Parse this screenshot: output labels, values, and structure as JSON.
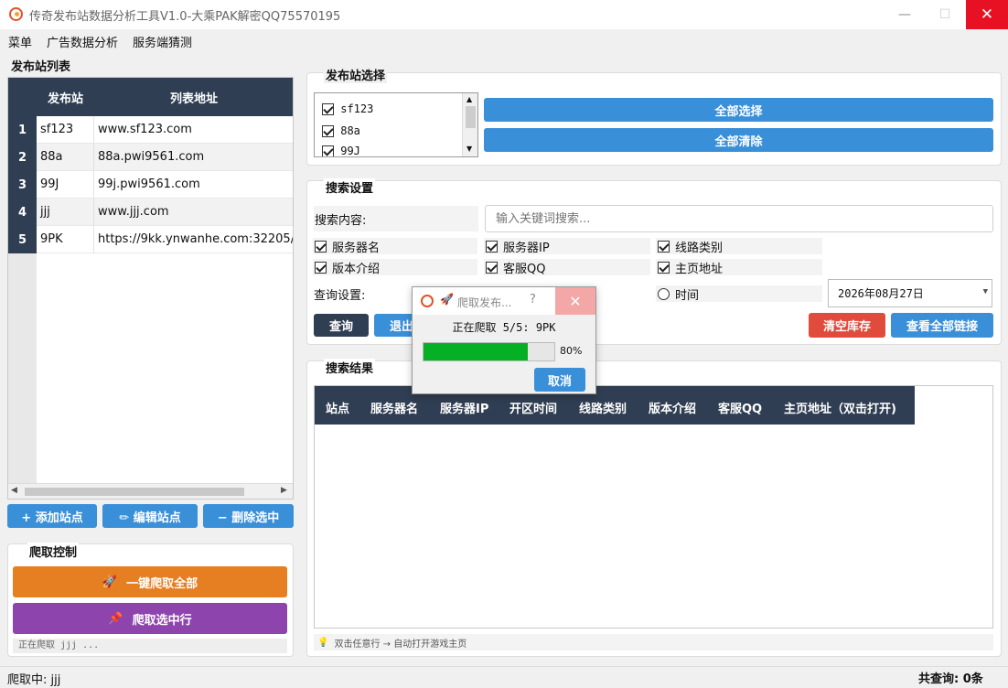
{
  "window": {
    "title": "传奇发布站数据分析工具V1.0-大乘PAK解密QQ75570195",
    "minimize": "—",
    "maximize": "☐",
    "close": "✕"
  },
  "menu": [
    "菜单",
    "广告数据分析",
    "服务端猜测"
  ],
  "site_list": {
    "label": "发布站列表",
    "columns": [
      "发布站",
      "列表地址"
    ],
    "rows": [
      {
        "num": "1",
        "site": "sf123",
        "url": "www.sf123.com"
      },
      {
        "num": "2",
        "site": "88a",
        "url": "88a.pwi9561.com"
      },
      {
        "num": "3",
        "site": "99J",
        "url": "99j.pwi9561.com"
      },
      {
        "num": "4",
        "site": "jjj",
        "url": "www.jjj.com"
      },
      {
        "num": "5",
        "site": "9PK",
        "url": "https://9kk.ynwanhe.com:32205/"
      }
    ],
    "buttons": {
      "add": "+ 添加站点",
      "edit": "✏ 编辑站点",
      "delete": "− 删除选中"
    }
  },
  "crawl_control": {
    "label": "爬取控制",
    "crawl_all": "一键爬取全部",
    "crawl_selected": "爬取选中行",
    "status": "正在爬取 jjj ..."
  },
  "site_select": {
    "label": "发布站选择",
    "items": [
      {
        "label": "sf123",
        "checked": true
      },
      {
        "label": "88a",
        "checked": true
      },
      {
        "label": "99J",
        "checked": true
      }
    ],
    "select_all": "全部选择",
    "clear_all": "全部清除"
  },
  "search": {
    "label": "搜索设置",
    "content_label": "搜索内容:",
    "placeholder": "输入关键词搜索...",
    "fields": [
      {
        "label": "服务器名",
        "checked": true
      },
      {
        "label": "服务器IP",
        "checked": true
      },
      {
        "label": "线路类别",
        "checked": true
      },
      {
        "label": "版本介绍",
        "checked": true
      },
      {
        "label": "客服QQ",
        "checked": true
      },
      {
        "label": "主页地址",
        "checked": true
      }
    ],
    "query_label": "查询设置:",
    "time_label": "时间",
    "date": "2026年08月27日",
    "query_btn": "查询",
    "exit_btn": "退出",
    "clear_btn": "清空库存",
    "view_links_btn": "查看全部链接"
  },
  "results": {
    "label": "搜索结果",
    "columns": [
      "站点",
      "服务器名",
      "服务器IP",
      "开区时间",
      "线路类别",
      "版本介绍",
      "客服QQ",
      "主页地址（双击打开)"
    ],
    "hint": "双击任意行 → 自动打开游戏主页"
  },
  "dialog": {
    "title": "爬取发布...",
    "help": "?",
    "close": "✕",
    "message": "正在爬取 5/5: 9PK",
    "progress": 0.8,
    "progress_text": "80%",
    "cancel": "取消"
  },
  "statusbar": {
    "left": "爬取中: jjj",
    "right": "共查询: 0条"
  },
  "colors": {
    "header": "#2f3e52",
    "blue": "#3a8fd9",
    "orange": "#e67e22",
    "purple": "#8e44ad",
    "red": "#e04b3c",
    "progress": "#06b025"
  }
}
